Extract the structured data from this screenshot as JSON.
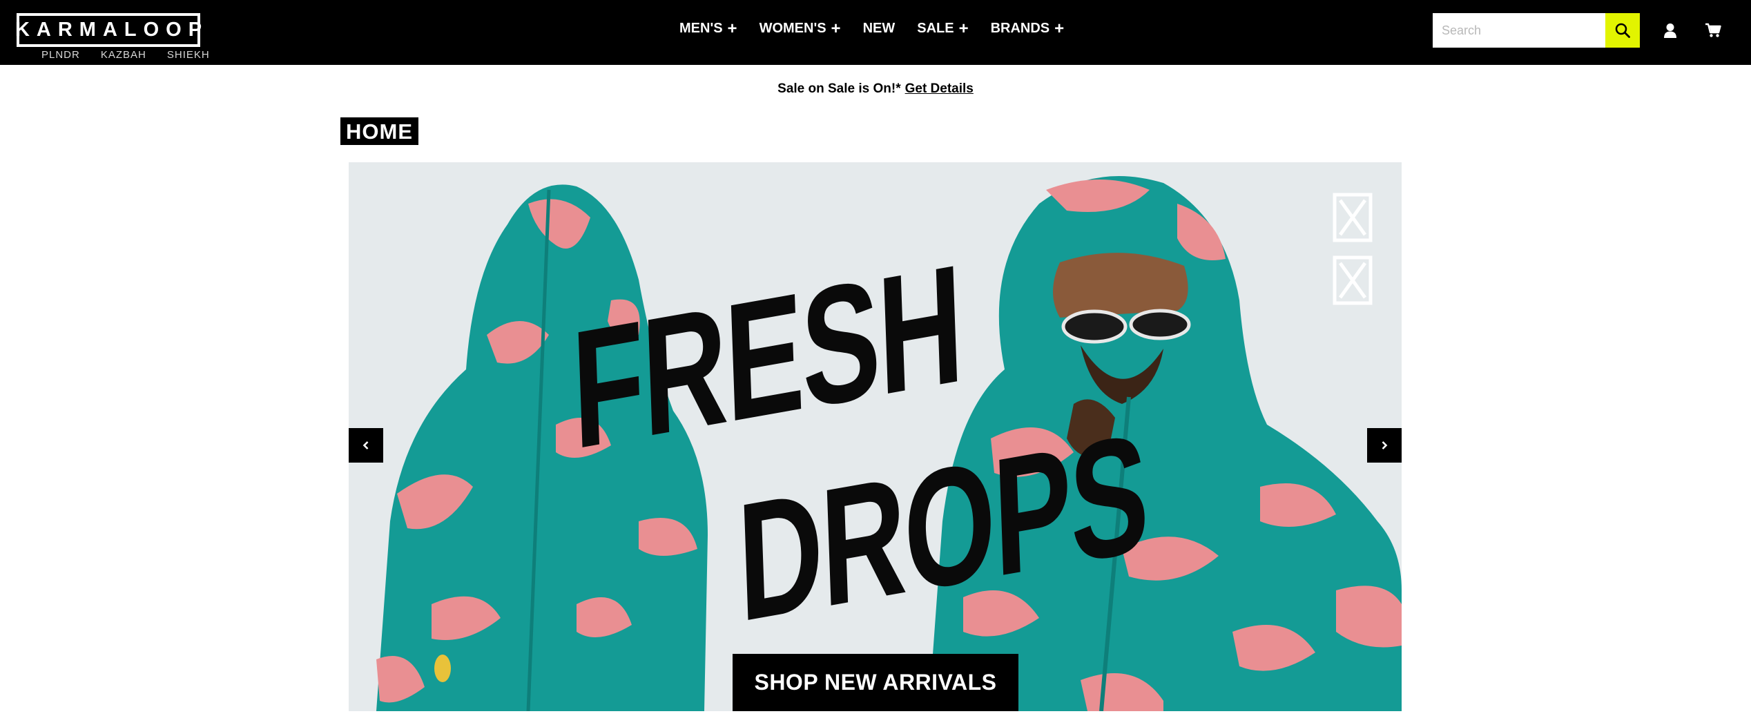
{
  "header": {
    "logo": "KARMALOOP",
    "sister_brands": [
      "PLNDR",
      "KAZBAH",
      "SHIEKH"
    ],
    "nav": [
      {
        "label": "MEN'S",
        "has_submenu": true
      },
      {
        "label": "WOMEN'S",
        "has_submenu": true
      },
      {
        "label": "NEW",
        "has_submenu": false
      },
      {
        "label": "SALE",
        "has_submenu": true
      },
      {
        "label": "BRANDS",
        "has_submenu": true
      }
    ],
    "search": {
      "placeholder": "Search",
      "value": ""
    },
    "icons": {
      "search": "search-icon",
      "account": "user-icon",
      "cart": "cart-icon"
    },
    "accent_color": "#e2f400"
  },
  "promo": {
    "text": "Sale on Sale is On!*",
    "link": "Get Details"
  },
  "page": {
    "title": "HOME"
  },
  "hero": {
    "headline_line1": "FRESH",
    "headline_line2": "DROPS",
    "cta": "SHOP NEW ARRIVALS",
    "prev_icon": "chevron-left-icon",
    "next_icon": "chevron-right-icon",
    "colors": {
      "teal": "#149b95",
      "pink": "#e98f92",
      "background": "#e5eaec"
    }
  }
}
